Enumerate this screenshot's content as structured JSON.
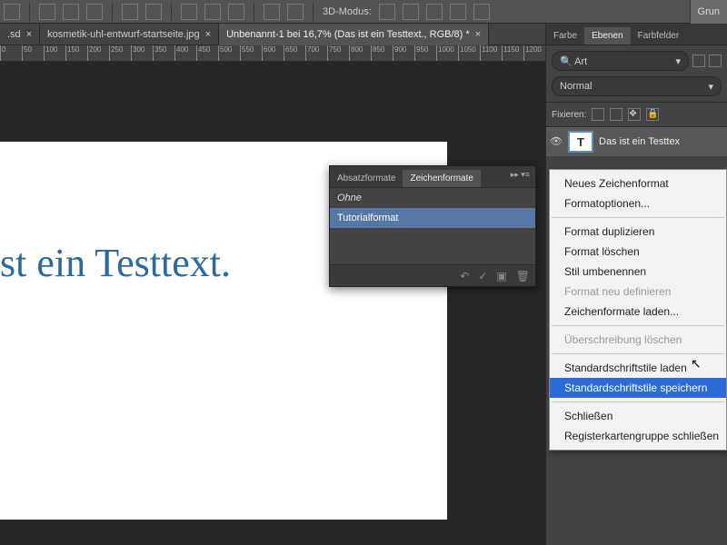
{
  "toolbar": {
    "mode_label": "3D-Modus:",
    "grun_label": "Grun"
  },
  "doc_tabs": [
    {
      "label": ".sd",
      "closable": true
    },
    {
      "label": "kosmetik-uhl-entwurf-startseite.jpg",
      "closable": true
    },
    {
      "label": "Unbenannt-1 bei 16,7% (Das ist ein Testtext., RGB/8) *",
      "closable": true,
      "active": true
    }
  ],
  "ruler_marks": [
    "0",
    "50",
    "100",
    "150",
    "200",
    "250",
    "300",
    "350",
    "400",
    "450",
    "500",
    "550",
    "600",
    "650",
    "700",
    "750",
    "800",
    "850",
    "900",
    "950",
    "1000",
    "1050",
    "1100",
    "1150",
    "1200"
  ],
  "canvas": {
    "text": "st ein Testtext."
  },
  "right_panel": {
    "tabs": [
      "Farbe",
      "Ebenen",
      "Farbfelder"
    ],
    "active_tab": "Ebenen",
    "filter_label": "Art",
    "blend_mode": "Normal",
    "lock_label": "Fixieren:",
    "layer": {
      "name": "Das ist ein Testtex",
      "type": "T"
    }
  },
  "char_panel": {
    "tabs": [
      "Absatzformate",
      "Zeichenformate"
    ],
    "active_tab": "Zeichenformate",
    "items": [
      "Ohne",
      "Tutorialformat"
    ],
    "selected": "Tutorialformat"
  },
  "context_menu": {
    "items": [
      {
        "label": "Neues Zeichenformat"
      },
      {
        "label": "Formatoptionen..."
      },
      {
        "sep": true
      },
      {
        "label": "Format duplizieren"
      },
      {
        "label": "Format löschen"
      },
      {
        "label": "Stil umbenennen"
      },
      {
        "label": "Format neu definieren",
        "disabled": true
      },
      {
        "label": "Zeichenformate laden..."
      },
      {
        "sep": true
      },
      {
        "label": "Überschreibung löschen",
        "disabled": true
      },
      {
        "sep": true
      },
      {
        "label": "Standardschriftstile laden"
      },
      {
        "label": "Standardschriftstile speichern",
        "hover": true
      },
      {
        "sep": true
      },
      {
        "label": "Schließen"
      },
      {
        "label": "Registerkartengruppe schließen"
      }
    ]
  }
}
